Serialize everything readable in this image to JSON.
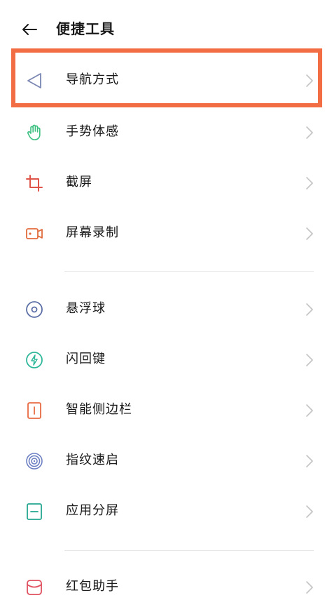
{
  "header": {
    "title": "便捷工具"
  },
  "items": [
    {
      "label": "导航方式",
      "icon": "navigation-arrow-icon"
    },
    {
      "label": "手势体感",
      "icon": "hand-gesture-icon"
    },
    {
      "label": "截屏",
      "icon": "crop-screenshot-icon"
    },
    {
      "label": "屏幕录制",
      "icon": "video-record-icon"
    },
    {
      "label": "悬浮球",
      "icon": "floating-ball-icon"
    },
    {
      "label": "闪回键",
      "icon": "flash-bolt-icon"
    },
    {
      "label": "智能侧边栏",
      "icon": "smart-sidebar-icon"
    },
    {
      "label": "指纹速启",
      "icon": "fingerprint-icon"
    },
    {
      "label": "应用分屏",
      "icon": "split-screen-icon"
    },
    {
      "label": "红包助手",
      "icon": "red-envelope-icon"
    }
  ],
  "colors": {
    "highlight": "#f26d43",
    "navigation": "#7a86b3",
    "gesture": "#3bbf7f",
    "crop": "#e0554a",
    "record": "#e26b3d",
    "floating": "#5c6ea6",
    "flash": "#2fb79a",
    "sidebar": "#e86b43",
    "fingerprint": "#6d7fc4",
    "split": "#23a68f",
    "envelope": "#e0505f"
  }
}
